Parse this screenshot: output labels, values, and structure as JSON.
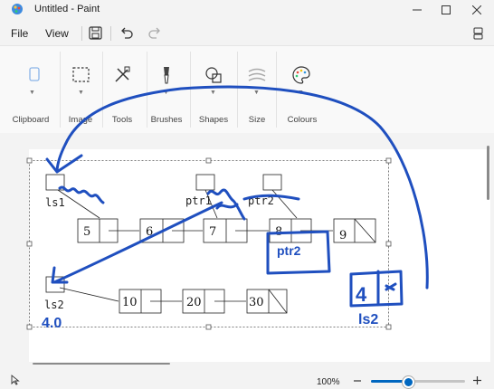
{
  "window": {
    "title": "Untitled - Paint"
  },
  "menu": {
    "file": "File",
    "view": "View"
  },
  "ribbon": {
    "groups": [
      {
        "label": "Clipboard"
      },
      {
        "label": "Image"
      },
      {
        "label": "Tools"
      },
      {
        "label": "Brushes"
      },
      {
        "label": "Shapes"
      },
      {
        "label": "Size"
      },
      {
        "label": "Colours"
      }
    ]
  },
  "drawing": {
    "pointer_labels": [
      "ls1",
      "ptr1",
      "ptr2",
      "ls2"
    ],
    "list1_values": [
      "5",
      "6",
      "7",
      "8",
      "9"
    ],
    "list2_values": [
      "10",
      "20",
      "30"
    ],
    "handwriting": [
      "ptr2",
      "4",
      "ls2",
      "4.0"
    ]
  },
  "status": {
    "zoom": "100%"
  },
  "colors": {
    "ink": "#1f4fbf",
    "accent": "#0067c0"
  }
}
